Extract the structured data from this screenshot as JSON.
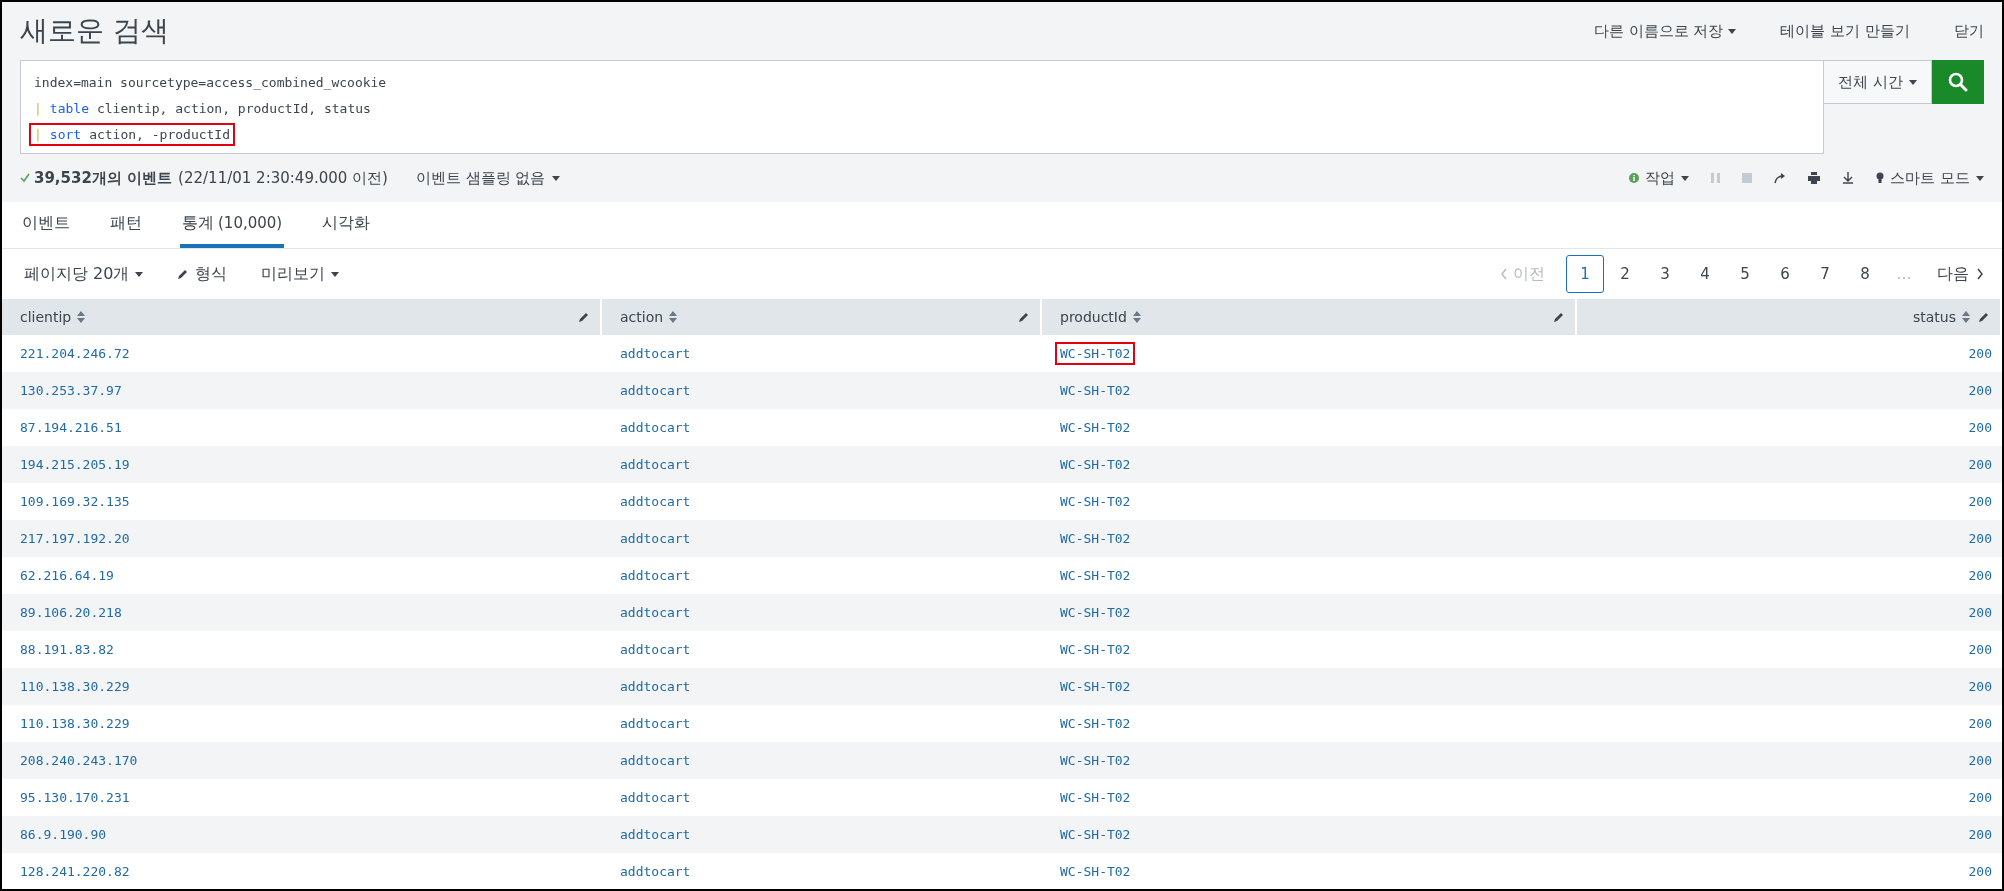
{
  "title": "새로운 검색",
  "header_actions": [
    {
      "label": "다른 이름으로 저장",
      "dropdown": true
    },
    {
      "label": "테이블 보기 만들기",
      "dropdown": false
    },
    {
      "label": "닫기",
      "dropdown": false
    }
  ],
  "search": {
    "lines": [
      {
        "highlighted": false,
        "tokens": [
          {
            "kind": "plain",
            "text": "index=main sourcetype=access_combined_wcookie"
          }
        ]
      },
      {
        "highlighted": false,
        "tokens": [
          {
            "kind": "pipe",
            "text": "|"
          },
          {
            "kind": "command",
            "text": "table"
          },
          {
            "kind": "plain",
            "text": "clientip, action, productId, status"
          }
        ]
      },
      {
        "highlighted": true,
        "tokens": [
          {
            "kind": "pipe",
            "text": "|"
          },
          {
            "kind": "command",
            "text": "sort"
          },
          {
            "kind": "plain",
            "text": "action, -productId"
          }
        ]
      }
    ],
    "time_range": "전체 시간"
  },
  "status": {
    "count": "39,532개의 이벤트",
    "time": "(22/11/01 2:30:49.000 이전)",
    "sampling": "이벤트 샘플링 없음",
    "job": "작업",
    "mode": "스마트 모드"
  },
  "tabs": [
    {
      "label": "이벤트",
      "selected": false
    },
    {
      "label": "패턴",
      "selected": false
    },
    {
      "label": "통계",
      "count": "(10,000)",
      "selected": true
    },
    {
      "label": "시각화",
      "selected": false
    }
  ],
  "toolbar": {
    "per_page": "페이지당 20개",
    "format": "형식",
    "preview": "미리보기"
  },
  "pagination": {
    "prev": "이전",
    "pages": [
      {
        "label": "1",
        "selected": true
      },
      {
        "label": "2",
        "selected": false
      },
      {
        "label": "3",
        "selected": false
      },
      {
        "label": "4",
        "selected": false
      },
      {
        "label": "5",
        "selected": false
      },
      {
        "label": "6",
        "selected": false
      },
      {
        "label": "7",
        "selected": false
      },
      {
        "label": "8",
        "selected": false
      }
    ],
    "ellipsis": "…",
    "next": "다음"
  },
  "table": {
    "columns": [
      {
        "label": "clientip"
      },
      {
        "label": "action"
      },
      {
        "label": "productId"
      },
      {
        "label": "status"
      }
    ],
    "rows": [
      {
        "clientip": "221.204.246.72",
        "action": "addtocart",
        "productId": "WC-SH-T02",
        "status": "200",
        "highlighted": true
      },
      {
        "clientip": "130.253.37.97",
        "action": "addtocart",
        "productId": "WC-SH-T02",
        "status": "200",
        "highlighted": false
      },
      {
        "clientip": "87.194.216.51",
        "action": "addtocart",
        "productId": "WC-SH-T02",
        "status": "200",
        "highlighted": false
      },
      {
        "clientip": "194.215.205.19",
        "action": "addtocart",
        "productId": "WC-SH-T02",
        "status": "200",
        "highlighted": false
      },
      {
        "clientip": "109.169.32.135",
        "action": "addtocart",
        "productId": "WC-SH-T02",
        "status": "200",
        "highlighted": false
      },
      {
        "clientip": "217.197.192.20",
        "action": "addtocart",
        "productId": "WC-SH-T02",
        "status": "200",
        "highlighted": false
      },
      {
        "clientip": "62.216.64.19",
        "action": "addtocart",
        "productId": "WC-SH-T02",
        "status": "200",
        "highlighted": false
      },
      {
        "clientip": "89.106.20.218",
        "action": "addtocart",
        "productId": "WC-SH-T02",
        "status": "200",
        "highlighted": false
      },
      {
        "clientip": "88.191.83.82",
        "action": "addtocart",
        "productId": "WC-SH-T02",
        "status": "200",
        "highlighted": false
      },
      {
        "clientip": "110.138.30.229",
        "action": "addtocart",
        "productId": "WC-SH-T02",
        "status": "200",
        "highlighted": false
      },
      {
        "clientip": "110.138.30.229",
        "action": "addtocart",
        "productId": "WC-SH-T02",
        "status": "200",
        "highlighted": false
      },
      {
        "clientip": "208.240.243.170",
        "action": "addtocart",
        "productId": "WC-SH-T02",
        "status": "200",
        "highlighted": false
      },
      {
        "clientip": "95.130.170.231",
        "action": "addtocart",
        "productId": "WC-SH-T02",
        "status": "200",
        "highlighted": false
      },
      {
        "clientip": "86.9.190.90",
        "action": "addtocart",
        "productId": "WC-SH-T02",
        "status": "200",
        "highlighted": false
      },
      {
        "clientip": "128.241.220.82",
        "action": "addtocart",
        "productId": "WC-SH-T02",
        "status": "200",
        "highlighted": false
      }
    ]
  }
}
